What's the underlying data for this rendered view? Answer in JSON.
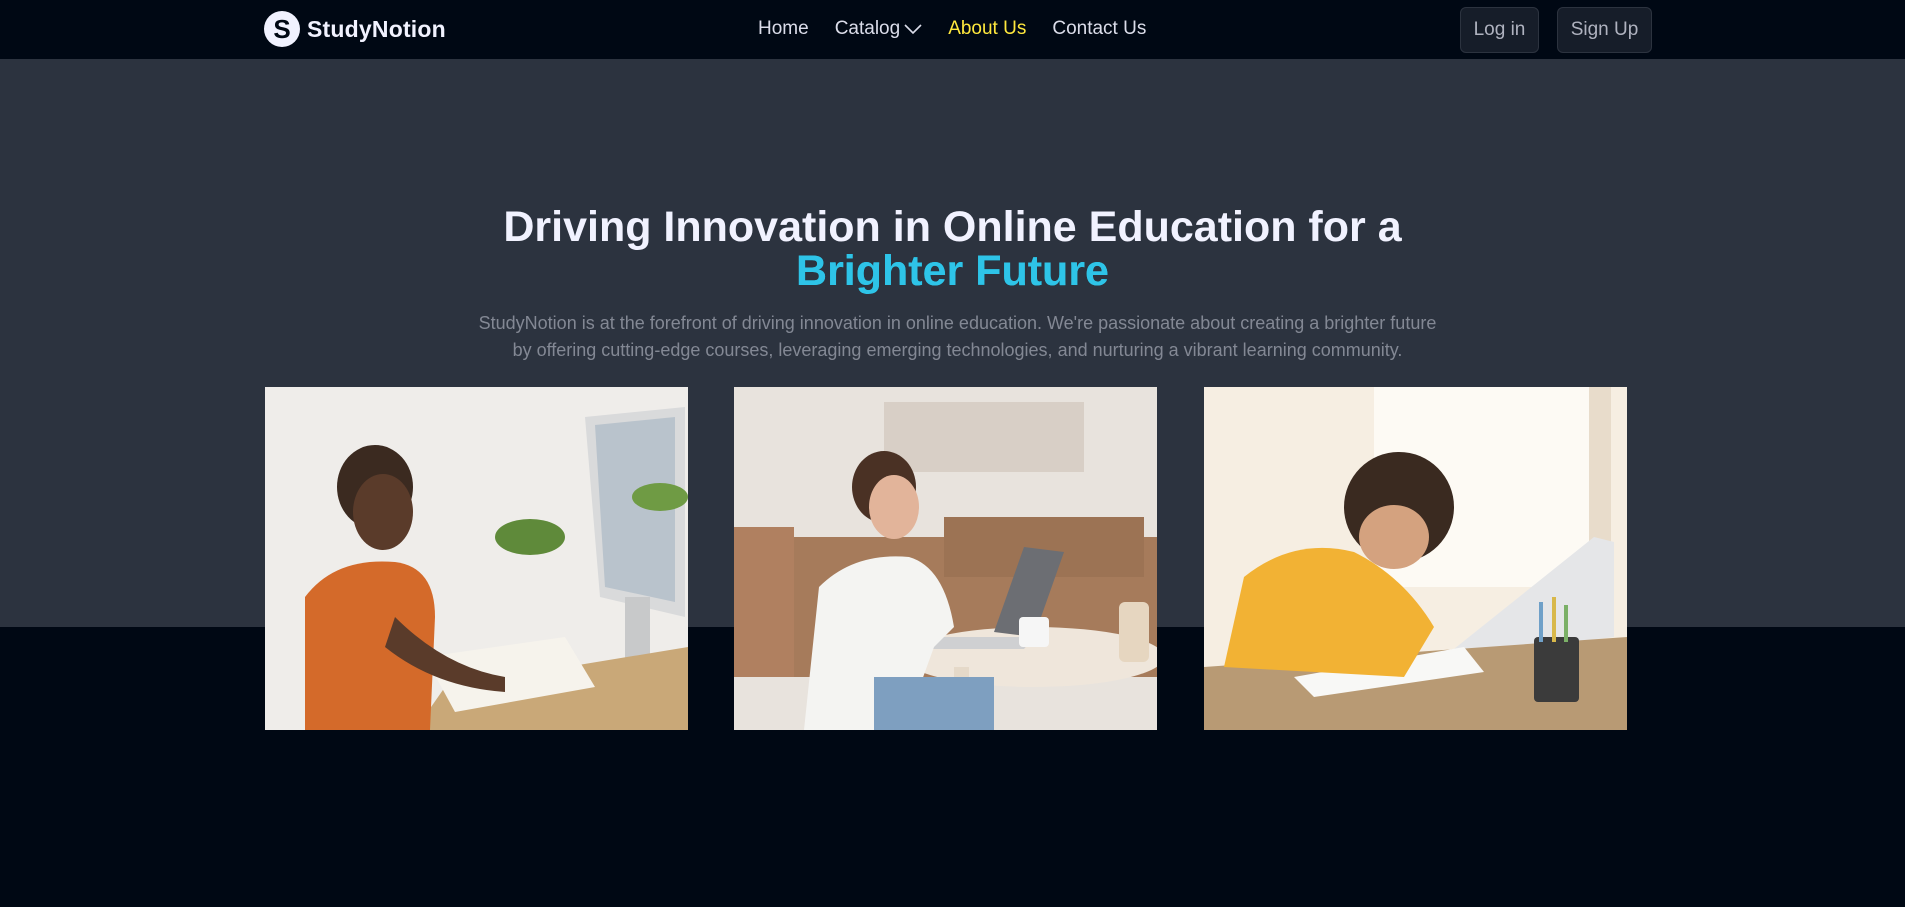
{
  "brand": {
    "name": "StudyNotion",
    "logo_letter": "S"
  },
  "nav": {
    "links": [
      {
        "label": "Home"
      },
      {
        "label": "Catalog",
        "has_dropdown": true
      },
      {
        "label": "About Us",
        "active": true
      },
      {
        "label": "Contact Us"
      }
    ],
    "login_label": "Log in",
    "signup_label": "Sign Up"
  },
  "hero": {
    "title_line1": "Driving Innovation in Online Education for a",
    "title_highlight": "Brighter Future",
    "description": "StudyNotion is at the forefront of driving innovation in online education. We're passionate about creating a brighter future by offering cutting-edge courses, leveraging emerging technologies, and nurturing a vibrant learning community."
  },
  "images": [
    {
      "icon": "photo-woman-at-computer"
    },
    {
      "icon": "photo-woman-with-laptop"
    },
    {
      "icon": "photo-girl-writing"
    }
  ],
  "colors": {
    "page_bg": "#000814",
    "hero_bg": "#2C333F",
    "active_link": "#FFE83D",
    "highlight": "#2EC4E8"
  }
}
